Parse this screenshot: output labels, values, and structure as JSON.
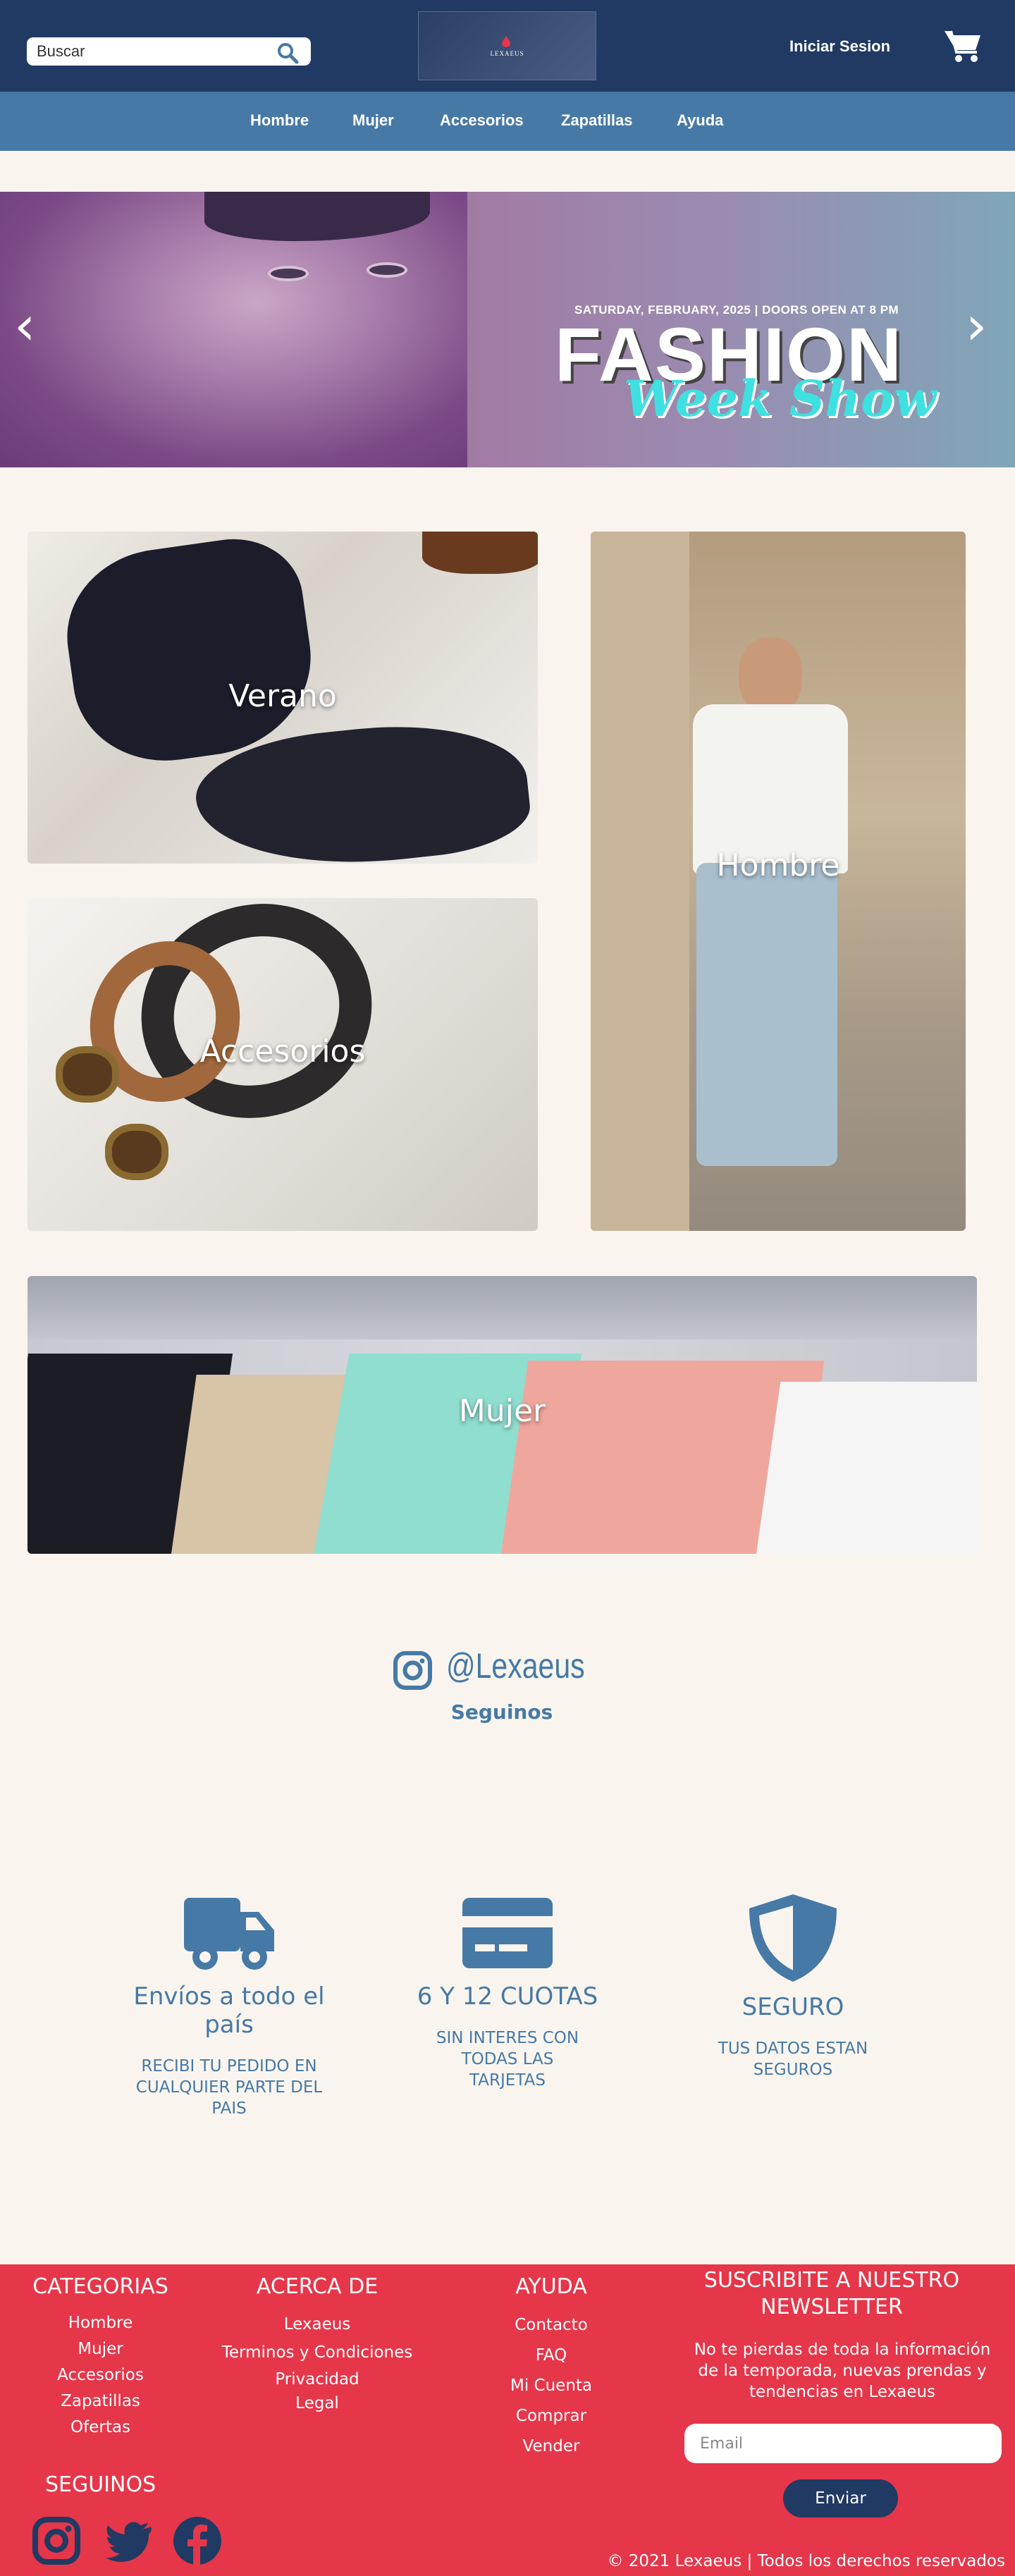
{
  "header": {
    "search_placeholder": "Buscar",
    "logo_text": "LEXAEUS",
    "login_label": "Iniciar Sesion"
  },
  "nav": {
    "items": [
      {
        "label": "Hombre"
      },
      {
        "label": "Mujer"
      },
      {
        "label": "Accesorios"
      },
      {
        "label": "Zapatillas"
      },
      {
        "label": "Ayuda"
      }
    ]
  },
  "hero": {
    "subtitle": "SATURDAY, FEBRUARY, 2025  |  DOORS OPEN AT 8 PM",
    "title": "FASHION",
    "script_title": "Week Show",
    "prev_icon": "‹",
    "next_icon": "›"
  },
  "categories": {
    "verano": "Verano",
    "hombre": "Hombre",
    "accesorios": "Accesorios",
    "mujer": "Mujer"
  },
  "social_cta": {
    "handle": "@Lexaeus",
    "follow_label": "Seguinos"
  },
  "features": [
    {
      "icon": "truck-icon",
      "title": "Envíos a todo el país",
      "desc": "RECIBI TU PEDIDO EN CUALQUIER PARTE DEL PAIS"
    },
    {
      "icon": "credit-card-icon",
      "title": "6 Y 12 CUOTAS",
      "desc": "SIN INTERES CON TODAS LAS TARJETAS"
    },
    {
      "icon": "shield-icon",
      "title": "SEGURO",
      "desc": "TUS DATOS ESTAN SEGUROS"
    }
  ],
  "footer": {
    "categorias": {
      "title": "CATEGORIAS",
      "links": [
        "Hombre",
        "Mujer",
        "Accesorios",
        "Zapatillas",
        "Ofertas"
      ]
    },
    "acerca": {
      "title": "ACERCA DE",
      "links": [
        "Lexaeus",
        "Terminos y Condiciones",
        "Privacidad",
        "Legal"
      ]
    },
    "ayuda": {
      "title": "AYUDA",
      "links": [
        "Contacto",
        "FAQ",
        "Mi Cuenta",
        "Comprar",
        "Vender"
      ]
    },
    "newsletter": {
      "title": "SUSCRIBITE A NUESTRO NEWSLETTER",
      "text": "No te pierdas de toda la información de la temporada, nuevas prendas y tendencias en Lexaeus",
      "email_placeholder": "Email",
      "button_label": "Enviar"
    },
    "seguinos": "SEGUINOS",
    "copyright": "© 2021 Lexaeus | Todos los derechos reservados"
  },
  "colors": {
    "header_bg": "#203a63",
    "nav_bg": "#4679a6",
    "page_bg": "#f9f5ee",
    "footer_bg": "#e5364a",
    "accent_blue": "#4679a6"
  }
}
